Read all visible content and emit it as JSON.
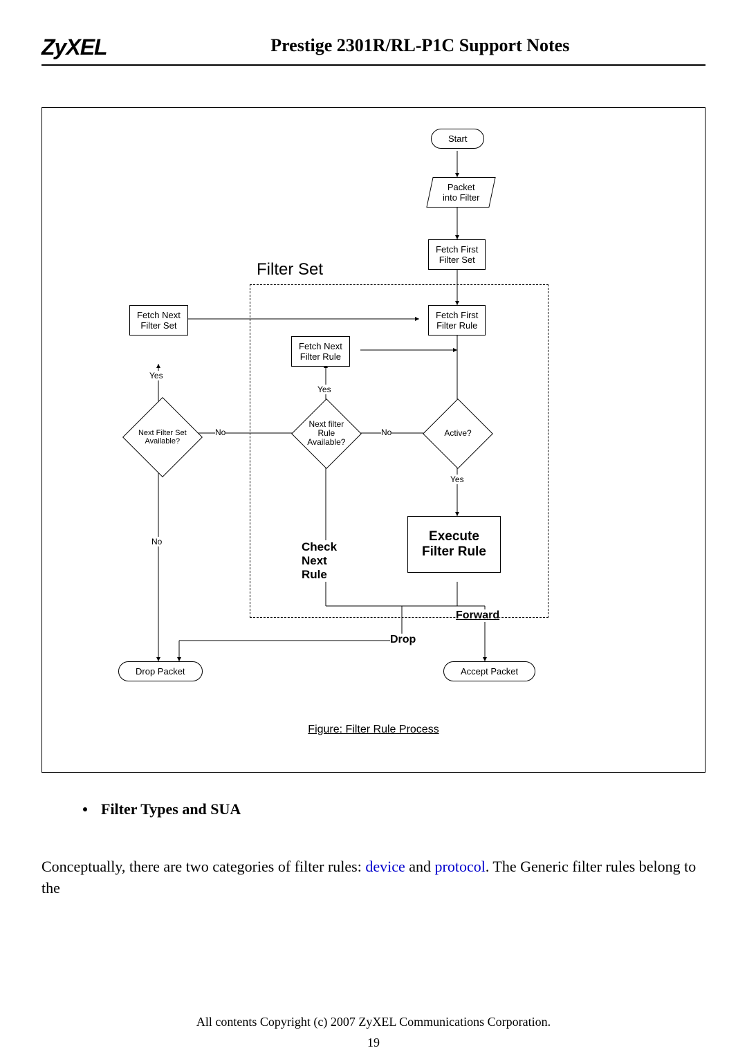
{
  "header": {
    "logo": "ZyXEL",
    "title": "Prestige 2301R/RL-P1C Support Notes"
  },
  "flowchart": {
    "section_title": "Filter Set",
    "start": "Start",
    "packet_into_filter": "Packet\ninto Filter",
    "fetch_first_set": "Fetch First\nFilter Set",
    "fetch_first_rule": "Fetch First\nFilter Rule",
    "fetch_next_set": "Fetch Next\nFilter Set",
    "fetch_next_rule": "Fetch Next\nFilter Rule",
    "next_set_avail": "Next Filter Set\nAvailable?",
    "next_rule_avail": "Next filter\nRule\nAvailable?",
    "active": "Active?",
    "execute": "Execute\nFilter Rule",
    "check_next": "Check\nNext\nRule",
    "forward": "Forward",
    "drop": "Drop",
    "drop_packet": "Drop Packet",
    "accept_packet": "Accept Packet",
    "yes": "Yes",
    "no": "No",
    "caption": "Figure: Filter Rule Process"
  },
  "content": {
    "bullet_title": "Filter Types and SUA",
    "para_pre": "Conceptually, there are two categories of filter rules: ",
    "link1": "device",
    "mid": " and ",
    "link2": "protocol",
    "para_post": ". The Generic filter rules belong to the"
  },
  "footer": {
    "copyright": "All contents Copyright (c) 2007 ZyXEL Communications Corporation.",
    "page": "19"
  }
}
